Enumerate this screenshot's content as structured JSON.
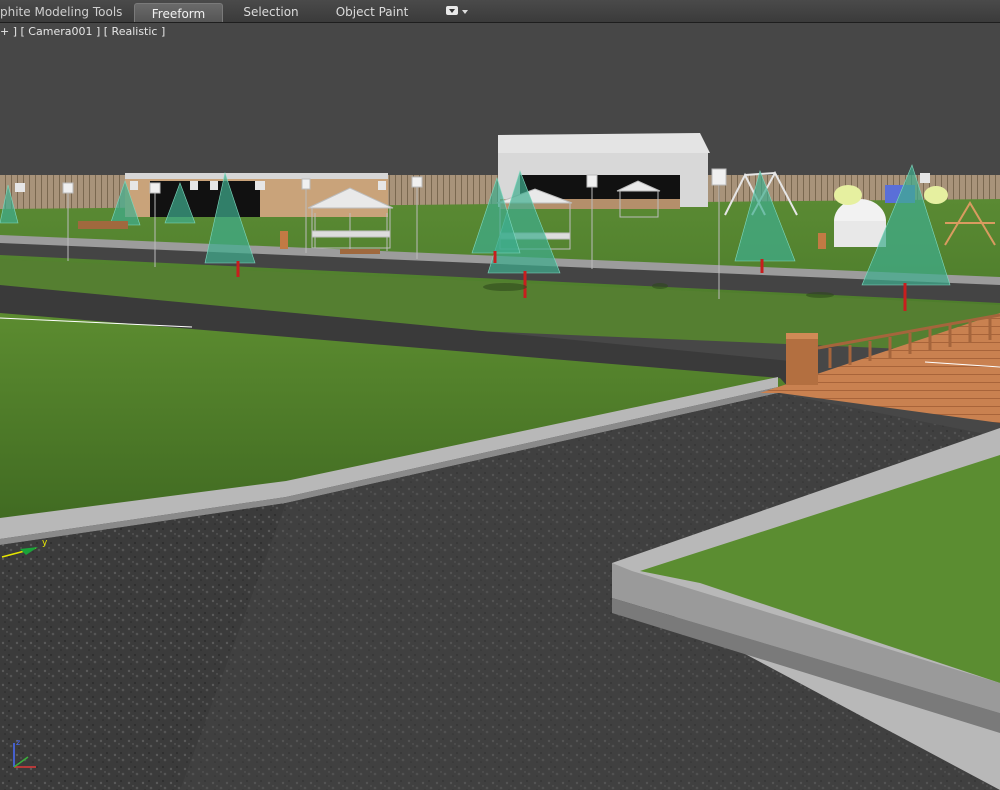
{
  "ribbon": {
    "app_tab_title": "phite Modeling Tools",
    "tabs": [
      {
        "label": "Freeform",
        "active": true
      },
      {
        "label": "Selection",
        "active": false
      },
      {
        "label": "Object Paint",
        "active": false
      }
    ],
    "menu_icon": "dropdown-menu-icon"
  },
  "viewport": {
    "menu_label": "+ ]",
    "camera_label": "[ Camera001 ]",
    "shading_label": "[ Realistic ]",
    "gizmo_axis_label": "y",
    "tripod_axis_label": "z"
  },
  "colors": {
    "sky": "#474747",
    "grass": "#4f7a2e",
    "asphalt": "#3d3d3d",
    "curb": "#a9a9a9",
    "deck": "#c9824e",
    "tree": "#3fae8f"
  }
}
